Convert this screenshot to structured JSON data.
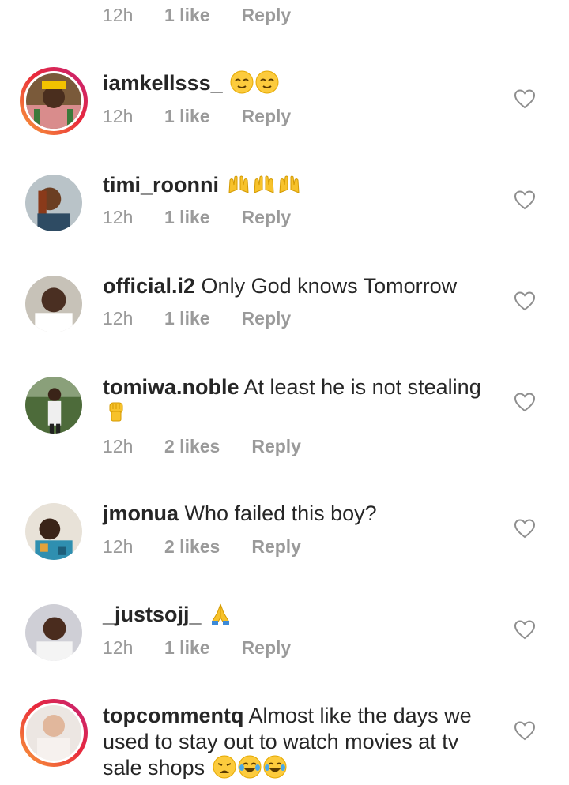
{
  "top_meta": {
    "time": "12h",
    "likes": "1 like",
    "reply": "Reply"
  },
  "comments": [
    {
      "username": "iamkellsss_",
      "text": "",
      "emoji": [
        "relieved-face",
        "relieved-face"
      ],
      "time": "12h",
      "likes": "1 like",
      "reply": "Reply",
      "story_ring": true
    },
    {
      "username": "timi_roonni",
      "text": "",
      "emoji": [
        "raising-hands",
        "raising-hands",
        "raising-hands"
      ],
      "time": "12h",
      "likes": "1 like",
      "reply": "Reply",
      "story_ring": false
    },
    {
      "username": "official.i2",
      "text": "Only God knows Tomorrow",
      "emoji": [],
      "time": "12h",
      "likes": "1 like",
      "reply": "Reply",
      "story_ring": false
    },
    {
      "username": "tomiwa.noble",
      "text": "At least he is not stealing",
      "emoji": [
        "raised-fist"
      ],
      "time": "12h",
      "likes": "2 likes",
      "reply": "Reply",
      "story_ring": false
    },
    {
      "username": "jmonua",
      "text": "Who failed this boy?",
      "emoji": [],
      "time": "12h",
      "likes": "2 likes",
      "reply": "Reply",
      "story_ring": false
    },
    {
      "username": "_justsojj_",
      "text": "",
      "emoji": [
        "folded-hands"
      ],
      "time": "12h",
      "likes": "1 like",
      "reply": "Reply",
      "story_ring": false
    },
    {
      "username": "topcommentq",
      "text": "Almost like the days we used to stay out to watch movies at tv sale shops",
      "emoji": [
        "weary-face",
        "tears-of-joy-face",
        "tears-of-joy-face"
      ],
      "time": "",
      "likes": "",
      "reply": "",
      "story_ring": true
    }
  ],
  "icons": {
    "like": "heart-outline-icon"
  },
  "colors": {
    "meta_text": "#9a9a9a",
    "text": "#262626",
    "heart_stroke": "#8e8e8e",
    "story_ring_start": "#f9a23a",
    "story_ring_end": "#c2227b"
  }
}
